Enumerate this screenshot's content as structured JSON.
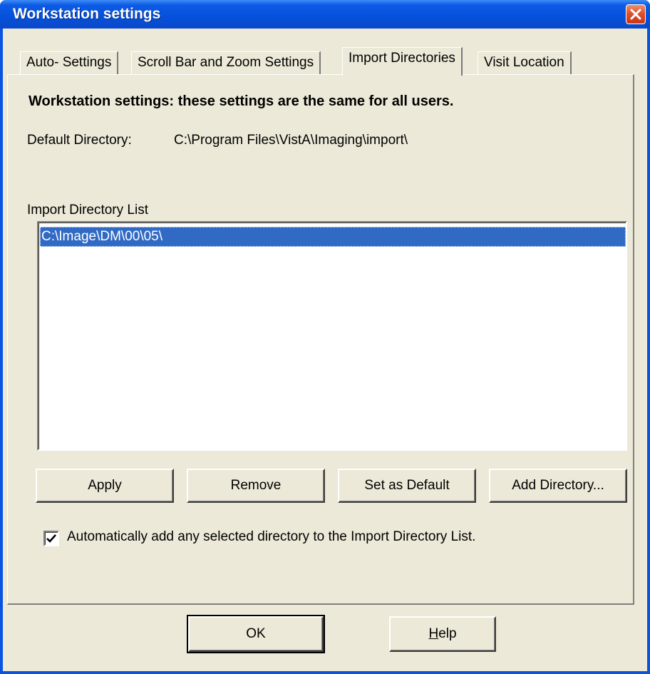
{
  "window": {
    "title": "Workstation settings",
    "close_icon": "close-icon"
  },
  "tabs": [
    {
      "label": "Auto- Settings",
      "active": false
    },
    {
      "label": "Scroll Bar and Zoom Settings",
      "active": false
    },
    {
      "label": "Import Directories",
      "active": true
    },
    {
      "label": "Visit Location",
      "active": false
    }
  ],
  "import_page": {
    "heading": "Workstation settings: these settings are the same for all users.",
    "default_directory_label": "Default Directory:",
    "default_directory_value": "C:\\Program Files\\VistA\\Imaging\\import\\",
    "list_label": "Import Directory List",
    "list_items": [
      "C:\\Image\\DM\\00\\05\\"
    ],
    "selected_item": "C:\\Image\\DM\\00\\05\\",
    "buttons": {
      "apply": "Apply",
      "remove": "Remove",
      "set_default": "Set as Default",
      "add_directory": "Add Directory..."
    },
    "auto_add_checkbox": {
      "label": "Automatically add any selected directory to the Import Directory List.",
      "checked": true
    }
  },
  "footer": {
    "ok_label": "OK",
    "help_label_rest": "elp",
    "help_label_mnemonic": "H"
  },
  "colors": {
    "titlebar": "#0551db",
    "dialog_bg": "#ece9d8",
    "selection": "#316ac5",
    "close_button": "#e0502c"
  }
}
